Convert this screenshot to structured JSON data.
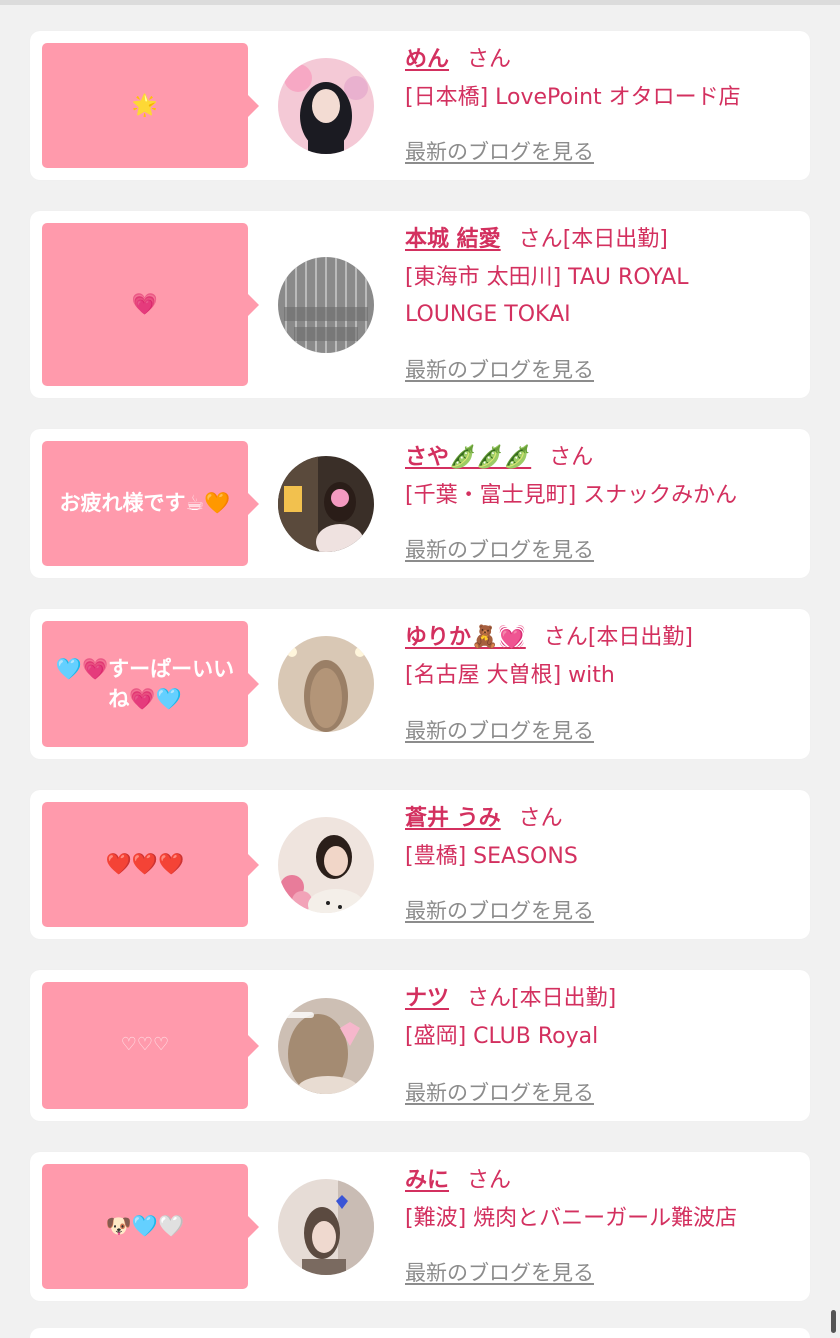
{
  "cards": [
    {
      "message": "🌟",
      "name": "めん",
      "san": "さん",
      "status": "",
      "shop": "[日本橋] LovePoint オタロード店",
      "blog_link": "最新のブログを見る"
    },
    {
      "message": "💗",
      "name": "本城 結愛",
      "san": "さん",
      "status": "[本日出勤]",
      "shop": "[東海市 太田川] TAU ROYAL LOUNGE TOKAI",
      "blog_link": "最新のブログを見る"
    },
    {
      "message": "お疲れ様です☕🧡",
      "name": "さや🫛🫛🫛",
      "san": "さん",
      "status": "",
      "shop": "[千葉・富士見町] スナックみかん",
      "blog_link": "最新のブログを見る"
    },
    {
      "message": "🩵💗すーぱーいいね💗🩵",
      "name": "ゆりか🧸💓",
      "san": "さん",
      "status": "[本日出勤]",
      "shop": "[名古屋 大曽根] with",
      "blog_link": "最新のブログを見る"
    },
    {
      "message": "❤️❤️❤️",
      "name": "蒼井 うみ",
      "san": "さん",
      "status": "",
      "shop": "[豊橋] SEASONS",
      "blog_link": "最新のブログを見る"
    },
    {
      "message": "♡♡♡",
      "name": "ナツ",
      "san": "さん",
      "status": "[本日出勤]",
      "shop": "[盛岡] CLUB Royal",
      "blog_link": "最新のブログを見る"
    },
    {
      "message": "🐶🩵🤍",
      "name": "みに",
      "san": "さん",
      "status": "",
      "shop": "[難波] 焼肉とバニーガール難波店",
      "blog_link": "最新のブログを見る"
    }
  ]
}
